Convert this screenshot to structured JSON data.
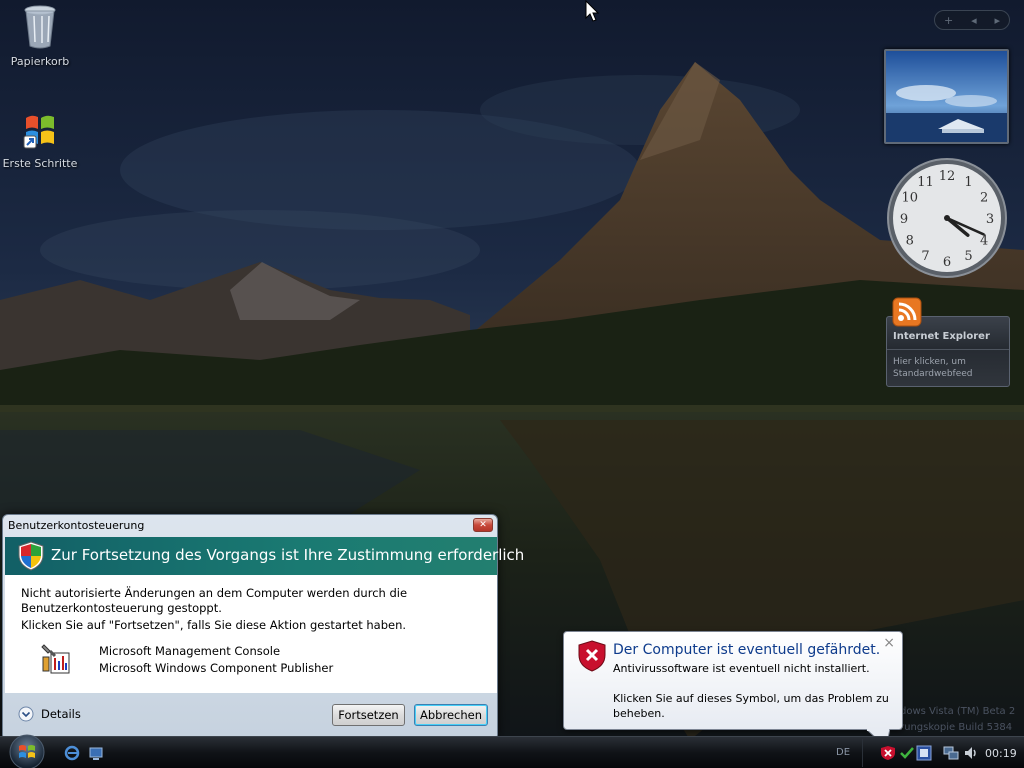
{
  "desktop": {
    "icons": [
      {
        "label": "Papierkorb"
      },
      {
        "label": "Erste Schritte"
      }
    ]
  },
  "sidebar": {
    "controls": {
      "add": "+",
      "prev": "◂",
      "next": "▸"
    },
    "clock": {
      "hour": 4,
      "minute": 19
    },
    "feed": {
      "title": "Internet Explorer",
      "text": "Hier klicken, um Standardwebfeed"
    }
  },
  "watermark": {
    "line1": "dows Vista (TM) Beta 2",
    "line2": "rungskopie Build 5384"
  },
  "uac": {
    "title": "Benutzerkontosteuerung",
    "close": "✕",
    "heading": "Zur Fortsetzung des Vorgangs ist Ihre Zustimmung erforderlich",
    "message_line1": "Nicht autorisierte Änderungen an dem Computer werden durch die",
    "message_line2": "Benutzerkontosteuerung gestoppt.",
    "message_line3": "Klicken Sie auf \"Fortsetzen\", falls Sie diese Aktion gestartet haben.",
    "app_name": "Microsoft Management Console",
    "publisher": "Microsoft Windows Component Publisher",
    "details_label": "Details",
    "continue_label": "Fortsetzen",
    "cancel_label": "Abbrechen"
  },
  "balloon": {
    "title": "Der Computer ist eventuell gefährdet.",
    "close": "×",
    "line1": "Antivirussoftware ist eventuell nicht installiert.",
    "line2": "Klicken Sie auf dieses Symbol, um das Problem zu",
    "line3": "beheben."
  },
  "taskbar": {
    "language": "DE",
    "clock": "00:19"
  },
  "colors": {
    "uac_banner": "#1a7a72",
    "balloon_title": "#0e3b8c",
    "error_red": "#c8102e"
  }
}
